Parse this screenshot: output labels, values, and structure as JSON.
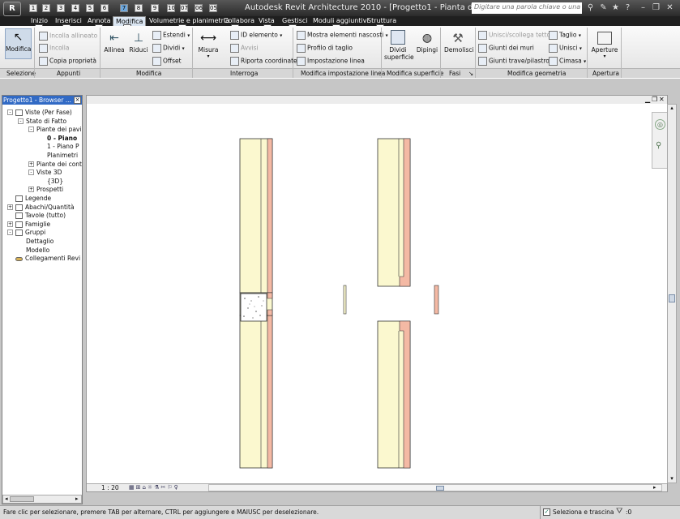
{
  "app": {
    "title": "Autodesk Revit Architecture 2010 - [Progetto1 - Pianta del p...",
    "app_button": "R",
    "search_placeholder": "Digitare una parola chiave o una fr..."
  },
  "quick_access": {
    "keytips": [
      "1",
      "2",
      "3",
      "4",
      "5",
      "6",
      "7",
      "8",
      "9",
      "10",
      "07",
      "06",
      "05"
    ]
  },
  "tabs": [
    {
      "label": "Inizio"
    },
    {
      "label": "Inserisci"
    },
    {
      "label": "Annota"
    },
    {
      "label": "Modifica"
    },
    {
      "label": "Volumetrie e planimetria"
    },
    {
      "label": "Collabora"
    },
    {
      "label": "Vista"
    },
    {
      "label": "Gestisci"
    },
    {
      "label": "Moduli aggiuntivi"
    },
    {
      "label": "Struttura"
    }
  ],
  "tab_keytips": [
    "H",
    "I",
    "A",
    "M",
    "S",
    "C",
    "V",
    "N",
    "D",
    "T"
  ],
  "ribbon": {
    "selezione": {
      "modifica_label": "Modifica",
      "panel": "Selezione"
    },
    "appunti": {
      "incolla_allineato": "Incolla allineato",
      "incolla": "Incolla",
      "copia_proprieta": "Copia proprietà",
      "panel": "Appunti"
    },
    "modifica": {
      "allinea": "Allinea",
      "riduci": "Riduci",
      "estendi": "Estendi",
      "dividi": "Dividi",
      "offset": "Offset",
      "panel": "Modifica"
    },
    "interroga": {
      "misura": "Misura",
      "id_elemento": "ID elemento",
      "avvisi": "Avvisi",
      "riporta_coordinate": "Riporta coordinate",
      "panel": "Interroga"
    },
    "modifica_impostazione": {
      "mostra_elementi": "Mostra elementi nascosti",
      "profilo_taglio": "Profilo di taglio",
      "impostazione_linea": "Impostazione linea",
      "panel": "Modifica impostazione linea"
    },
    "modifica_superficie": {
      "dividi_superficie": "Dividi superficie",
      "dipingi": "Dipingi",
      "panel": "Modifica superficie"
    },
    "fasi": {
      "demolisci": "Demolisci",
      "panel": "Fasi"
    },
    "modifica_geometria": {
      "unisci_scolleg": "Unisci/scollega tetto",
      "giunti_muri": "Giunti dei muri",
      "giunti_trave": "Giunti trave/pilastro",
      "taglio": "Taglio",
      "unisci": "Unisci",
      "cimasa": "Cimasa",
      "panel": "Modifica geometria"
    },
    "apertura": {
      "aperture": "Aperture",
      "panel": "Apertura"
    }
  },
  "browser": {
    "title": "Progetto1 - Browser ...",
    "close": "×",
    "nodes": [
      {
        "label": "Viste (Per Fase)",
        "level": 0,
        "expander": "-",
        "icon": "views-icon"
      },
      {
        "label": "Stato di Fatto",
        "level": 1,
        "expander": "-",
        "icon": ""
      },
      {
        "label": "Piante dei pavi",
        "level": 2,
        "expander": "-",
        "icon": ""
      },
      {
        "label": "0 - Piano",
        "level": 3,
        "expander": "",
        "icon": "",
        "bold": true
      },
      {
        "label": "1 - Piano P",
        "level": 3,
        "expander": "",
        "icon": ""
      },
      {
        "label": "Planimetri",
        "level": 3,
        "expander": "",
        "icon": ""
      },
      {
        "label": "Piante dei cont",
        "level": 2,
        "expander": "+",
        "icon": ""
      },
      {
        "label": "Viste 3D",
        "level": 2,
        "expander": "-",
        "icon": ""
      },
      {
        "label": "{3D}",
        "level": 3,
        "expander": "",
        "icon": ""
      },
      {
        "label": "Prospetti",
        "level": 2,
        "expander": "+",
        "icon": ""
      },
      {
        "label": "Legende",
        "level": 0,
        "expander": "",
        "icon": "legend-icon"
      },
      {
        "label": "Abachi/Quantità",
        "level": 0,
        "expander": "+",
        "icon": "schedule-icon"
      },
      {
        "label": "Tavole (tutto)",
        "level": 0,
        "expander": "",
        "icon": "sheet-icon"
      },
      {
        "label": "Famiglie",
        "level": 0,
        "expander": "+",
        "icon": "family-icon"
      },
      {
        "label": "Gruppi",
        "level": 0,
        "expander": "-",
        "icon": "group-icon"
      },
      {
        "label": "Dettaglio",
        "level": 1,
        "expander": "",
        "icon": ""
      },
      {
        "label": "Modello",
        "level": 1,
        "expander": "",
        "icon": ""
      },
      {
        "label": "Collegamenti Revi",
        "level": 0,
        "expander": "",
        "icon": "link-icon"
      }
    ]
  },
  "view": {
    "scale": "1 : 20"
  },
  "status": {
    "message": "Fare clic per selezionare, premere TAB per alternare, CTRL per aggiungere e MAIUSC per deselezionare.",
    "drag_label": "Seleziona e trascina",
    "filter_count": ":0"
  },
  "colors": {
    "wall_fill": "#fbf8cf",
    "finish_fill": "#f4b9a4",
    "wall_line": "#333333",
    "accent": "#316ac5"
  }
}
